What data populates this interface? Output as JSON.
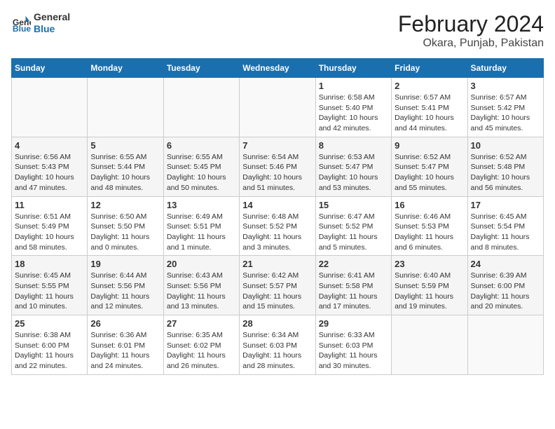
{
  "header": {
    "logo_general": "General",
    "logo_blue": "Blue",
    "title": "February 2024",
    "subtitle": "Okara, Punjab, Pakistan"
  },
  "weekdays": [
    "Sunday",
    "Monday",
    "Tuesday",
    "Wednesday",
    "Thursday",
    "Friday",
    "Saturday"
  ],
  "weeks": [
    [
      {
        "day": "",
        "info": ""
      },
      {
        "day": "",
        "info": ""
      },
      {
        "day": "",
        "info": ""
      },
      {
        "day": "",
        "info": ""
      },
      {
        "day": "1",
        "sunrise": "6:58 AM",
        "sunset": "5:40 PM",
        "daylight": "10 hours and 42 minutes."
      },
      {
        "day": "2",
        "sunrise": "6:57 AM",
        "sunset": "5:41 PM",
        "daylight": "10 hours and 44 minutes."
      },
      {
        "day": "3",
        "sunrise": "6:57 AM",
        "sunset": "5:42 PM",
        "daylight": "10 hours and 45 minutes."
      }
    ],
    [
      {
        "day": "4",
        "sunrise": "6:56 AM",
        "sunset": "5:43 PM",
        "daylight": "10 hours and 47 minutes."
      },
      {
        "day": "5",
        "sunrise": "6:55 AM",
        "sunset": "5:44 PM",
        "daylight": "10 hours and 48 minutes."
      },
      {
        "day": "6",
        "sunrise": "6:55 AM",
        "sunset": "5:45 PM",
        "daylight": "10 hours and 50 minutes."
      },
      {
        "day": "7",
        "sunrise": "6:54 AM",
        "sunset": "5:46 PM",
        "daylight": "10 hours and 51 minutes."
      },
      {
        "day": "8",
        "sunrise": "6:53 AM",
        "sunset": "5:47 PM",
        "daylight": "10 hours and 53 minutes."
      },
      {
        "day": "9",
        "sunrise": "6:52 AM",
        "sunset": "5:47 PM",
        "daylight": "10 hours and 55 minutes."
      },
      {
        "day": "10",
        "sunrise": "6:52 AM",
        "sunset": "5:48 PM",
        "daylight": "10 hours and 56 minutes."
      }
    ],
    [
      {
        "day": "11",
        "sunrise": "6:51 AM",
        "sunset": "5:49 PM",
        "daylight": "10 hours and 58 minutes."
      },
      {
        "day": "12",
        "sunrise": "6:50 AM",
        "sunset": "5:50 PM",
        "daylight": "11 hours and 0 minutes."
      },
      {
        "day": "13",
        "sunrise": "6:49 AM",
        "sunset": "5:51 PM",
        "daylight": "11 hours and 1 minute."
      },
      {
        "day": "14",
        "sunrise": "6:48 AM",
        "sunset": "5:52 PM",
        "daylight": "11 hours and 3 minutes."
      },
      {
        "day": "15",
        "sunrise": "6:47 AM",
        "sunset": "5:52 PM",
        "daylight": "11 hours and 5 minutes."
      },
      {
        "day": "16",
        "sunrise": "6:46 AM",
        "sunset": "5:53 PM",
        "daylight": "11 hours and 6 minutes."
      },
      {
        "day": "17",
        "sunrise": "6:45 AM",
        "sunset": "5:54 PM",
        "daylight": "11 hours and 8 minutes."
      }
    ],
    [
      {
        "day": "18",
        "sunrise": "6:45 AM",
        "sunset": "5:55 PM",
        "daylight": "11 hours and 10 minutes."
      },
      {
        "day": "19",
        "sunrise": "6:44 AM",
        "sunset": "5:56 PM",
        "daylight": "11 hours and 12 minutes."
      },
      {
        "day": "20",
        "sunrise": "6:43 AM",
        "sunset": "5:56 PM",
        "daylight": "11 hours and 13 minutes."
      },
      {
        "day": "21",
        "sunrise": "6:42 AM",
        "sunset": "5:57 PM",
        "daylight": "11 hours and 15 minutes."
      },
      {
        "day": "22",
        "sunrise": "6:41 AM",
        "sunset": "5:58 PM",
        "daylight": "11 hours and 17 minutes."
      },
      {
        "day": "23",
        "sunrise": "6:40 AM",
        "sunset": "5:59 PM",
        "daylight": "11 hours and 19 minutes."
      },
      {
        "day": "24",
        "sunrise": "6:39 AM",
        "sunset": "6:00 PM",
        "daylight": "11 hours and 20 minutes."
      }
    ],
    [
      {
        "day": "25",
        "sunrise": "6:38 AM",
        "sunset": "6:00 PM",
        "daylight": "11 hours and 22 minutes."
      },
      {
        "day": "26",
        "sunrise": "6:36 AM",
        "sunset": "6:01 PM",
        "daylight": "11 hours and 24 minutes."
      },
      {
        "day": "27",
        "sunrise": "6:35 AM",
        "sunset": "6:02 PM",
        "daylight": "11 hours and 26 minutes."
      },
      {
        "day": "28",
        "sunrise": "6:34 AM",
        "sunset": "6:03 PM",
        "daylight": "11 hours and 28 minutes."
      },
      {
        "day": "29",
        "sunrise": "6:33 AM",
        "sunset": "6:03 PM",
        "daylight": "11 hours and 30 minutes."
      },
      {
        "day": "",
        "info": ""
      },
      {
        "day": "",
        "info": ""
      }
    ]
  ],
  "labels": {
    "sunrise_prefix": "Sunrise: ",
    "sunset_prefix": "Sunset: ",
    "daylight_label": "Daylight hours"
  }
}
